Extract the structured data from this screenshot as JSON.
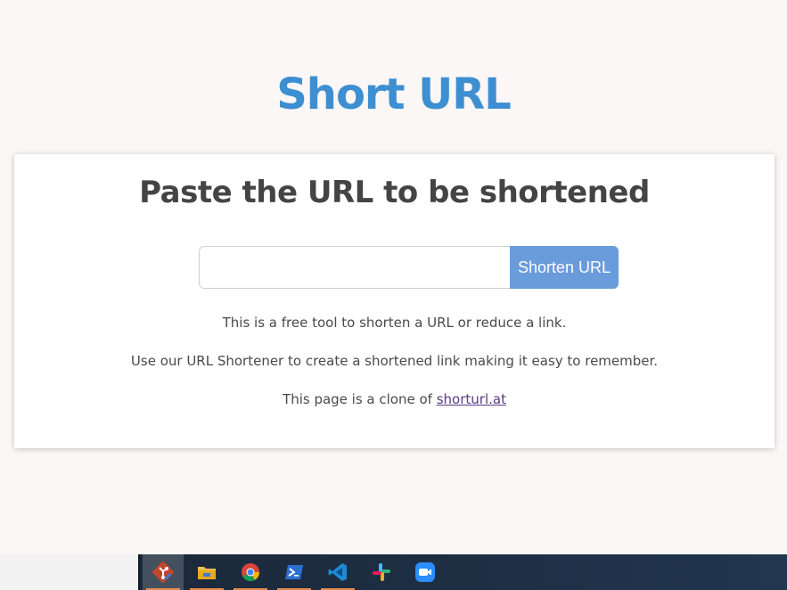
{
  "site": {
    "title": "Short URL"
  },
  "card": {
    "heading": "Paste the URL to be shortened",
    "input": {
      "value": "",
      "placeholder": ""
    },
    "button_label": "Shorten URL",
    "info_1": "This is a free tool to shorten a URL or reduce a link.",
    "info_2": "Use our URL Shortener to create a shortened link making it easy to remember.",
    "info_3_prefix": "This page is a clone of ",
    "info_3_link": "shorturl.at"
  },
  "colors": {
    "page_background": "#faf7f6",
    "title": "#3d8fd1",
    "button": "#6a9bdb",
    "heading": "#444444",
    "link": "#5a3a86"
  },
  "taskbar": {
    "apps": [
      {
        "icon": "git-icon",
        "active": true
      },
      {
        "icon": "file-explorer-icon",
        "active": false
      },
      {
        "icon": "chrome-icon",
        "active": false
      },
      {
        "icon": "powershell-icon",
        "active": false
      },
      {
        "icon": "vscode-icon",
        "active": false
      },
      {
        "icon": "slack-icon",
        "active": false
      },
      {
        "icon": "zoom-icon",
        "active": false
      }
    ]
  }
}
